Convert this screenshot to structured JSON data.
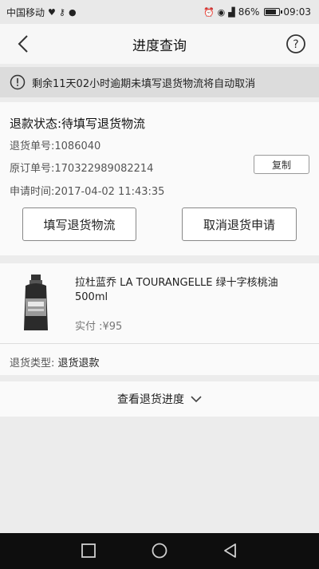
{
  "status_bar": {
    "carrier": "中国移动",
    "battery": "86%",
    "battery_level": 0.86,
    "time": "09:03"
  },
  "header": {
    "title": "进度查询"
  },
  "notice": {
    "text": "剩余11天02小时逾期未填写退货物流将自动取消"
  },
  "refund": {
    "status": "退款状态:待填写退货物流",
    "return_no": "退货单号:1086040",
    "order_no": "原订单号:170322989082214",
    "apply_time": "申请时间:2017-04-02 11:43:35",
    "copy_label": "复制",
    "fill_logistics_label": "填写退货物流",
    "cancel_label": "取消退货申请"
  },
  "product": {
    "name": "拉杜蓝乔 LA TOURANGELLE 绿十字核桃油500ml",
    "price": "实付 :¥95",
    "return_type_label": "退货类型:",
    "return_type_value": "退货退款"
  },
  "progress": {
    "label": "查看退货进度"
  },
  "icons": {
    "back": "back-arrow-icon",
    "help": "question-circle-icon",
    "notice": "exclamation-circle-icon",
    "chevron": "chevron-down-icon",
    "nav_recent": "square-icon",
    "nav_home": "circle-icon",
    "nav_back": "triangle-back-icon"
  }
}
